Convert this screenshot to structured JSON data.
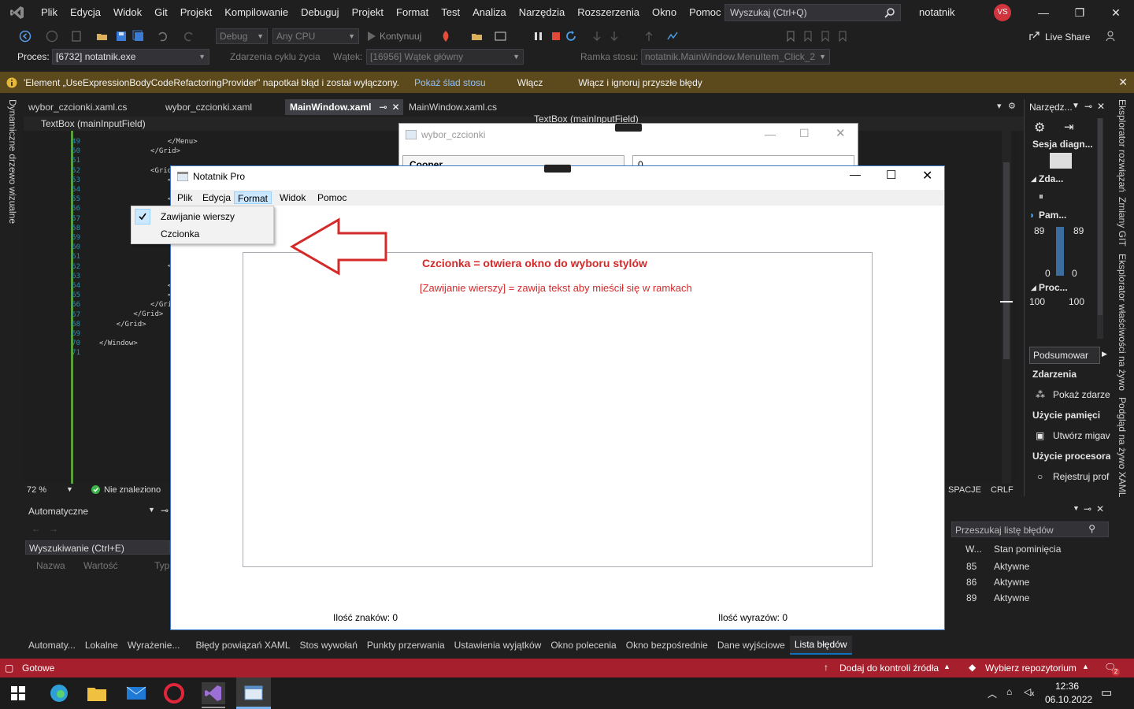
{
  "menu": {
    "items": [
      "Plik",
      "Edycja",
      "Widok",
      "Git",
      "Projekt",
      "Kompilowanie",
      "Debuguj",
      "Projekt",
      "Format",
      "Test",
      "Analiza",
      "Narzędzia",
      "Rozszerzenia",
      "Okno",
      "Pomoc"
    ],
    "search_placeholder": "Wyszukaj (Ctrl+Q)",
    "solution_name": "notatnik",
    "avatar_initials": "VS"
  },
  "toolbar": {
    "config": "Debug",
    "platform": "Any CPU",
    "continue_label": "Kontynuuj",
    "live_share": "Live Share",
    "process_label": "Proces:",
    "process_value": "[6732] notatnik.exe",
    "lifecycle_label": "Zdarzenia cyklu życia",
    "thread_label": "Wątek:",
    "thread_value": "[16956] Wątek główny",
    "stackframe_label": "Ramka stosu:",
    "stackframe_value": "notatnik.MainWindow.MenuItem_Click_2"
  },
  "infobar": {
    "message": "'Element „UseExpressionBodyCodeRefactoringProvider” napotkał błąd i został wyłączony.",
    "show_stack": "Pokaż ślad stosu",
    "enable": "Włącz",
    "enable_ignore": "Włącz i ignoruj przyszłe błędy"
  },
  "tabs": [
    "wybor_czcionki.xaml.cs",
    "wybor_czcionki.xaml",
    "MainWindow.xaml",
    "MainWindow.xaml.cs"
  ],
  "active_tab_index": 2,
  "navbar": {
    "left": "TextBox (mainInputField)",
    "right": "TextBox (mainInputField)"
  },
  "editor": {
    "line_numbers": [
      "49",
      "50",
      "51",
      "52",
      "53",
      "54",
      "55",
      "56",
      "57",
      "58",
      "59",
      "60",
      "61",
      "62",
      "63",
      "64",
      "65",
      "66",
      "67",
      "68",
      "69",
      "70",
      "71"
    ],
    "code_lines": [
      "                </Menu>",
      "            </Grid>",
      "",
      "            <Grid Gri",
      "                <Text",
      "",
      "                </Tex",
      "",
      "",
      "",
      "",
      "                    <",
      "                    <",
      "                </Gri",
      "",
      "                <Text",
      "                <Text",
      "            </Grid>",
      "        </Grid>",
      "    </Grid>",
      "",
      "</Window>",
      ""
    ],
    "zoom": "72 %",
    "issues": "Nie znaleziono",
    "indent": "SPACJE",
    "eol": "CRLF"
  },
  "left_strip_label": "Dynamiczne drzewo wizualne",
  "right_strip_labels": [
    "Eksplorator rozwiązań",
    "Zmiany GIT",
    "Eksplorator właściwości na żywo",
    "Podgląd na żywo XAML"
  ],
  "diag": {
    "title": "Narzędz...",
    "session": "Sesja diagn...",
    "events": "Zda...",
    "memory": "Pam...",
    "mem_max_left": "89",
    "mem_max_right": "89",
    "mem_min_left": "0",
    "mem_min_right": "0",
    "cpu": "Proc...",
    "cpu_max_left": "100",
    "cpu_max_right": "100",
    "summary_tab": "Podsumowar",
    "events_header": "Zdarzenia",
    "show_events": "Pokaż zdarze",
    "memory_header": "Użycie pamięci",
    "snapshot": "Utwórz migav",
    "cpu_header": "Użycie procesora",
    "record": "Rejestruj prof"
  },
  "autos": {
    "title": "Automatyczne",
    "search": "Wyszukiwanie (Ctrl+E)",
    "columns": [
      "Nazwa",
      "Wartość",
      "Typ"
    ]
  },
  "errors": {
    "search": "Przeszukaj listę błędów",
    "columns": [
      "W...",
      "Stan pominięcia"
    ],
    "rows": [
      [
        "85",
        "Aktywne"
      ],
      [
        "86",
        "Aktywne"
      ],
      [
        "89",
        "Aktywne"
      ]
    ]
  },
  "bottom_tabs": [
    "Automaty...",
    "Lokalne",
    "Wyrażenie...",
    "Błędy powiązań XAML",
    "Stos wywołań",
    "Punkty przerwania",
    "Ustawienia wyjątków",
    "Okno polecenia",
    "Okno bezpośrednie",
    "Dane wyjściowe",
    "Lista błędów"
  ],
  "status": {
    "ready": "Gotowe",
    "add_source": "Dodaj do kontroli źródła",
    "repo": "Wybierz repozytorium",
    "notif_count": "2"
  },
  "taskbar": {
    "time": "12:36",
    "date": "06.10.2022"
  },
  "fontwin": {
    "title": "wybor_czcionki",
    "font_value": "Cooper",
    "size_value": "0"
  },
  "notepad": {
    "title": "Notatnik Pro",
    "menu": [
      "Plik",
      "Edycja",
      "Format",
      "Widok",
      "Pomoc"
    ],
    "active_menu_index": 2,
    "dropdown": {
      "wrap": "Zawijanie wierszy",
      "font": "Czcionka"
    },
    "annotation1": "Czcionka = otwiera okno do wyboru stylów",
    "annotation2": "[Zawijanie wierszy]  = zawija tekst aby mieścił się w ramkach",
    "char_count": "Ilość znaków: 0",
    "word_count": "Ilość wyrazów: 0"
  },
  "colors": {
    "accent": "#0e70c0",
    "status_bar": "#a5202c",
    "infobar": "#5c4a1d",
    "annotation_red": "#d42a2a"
  }
}
